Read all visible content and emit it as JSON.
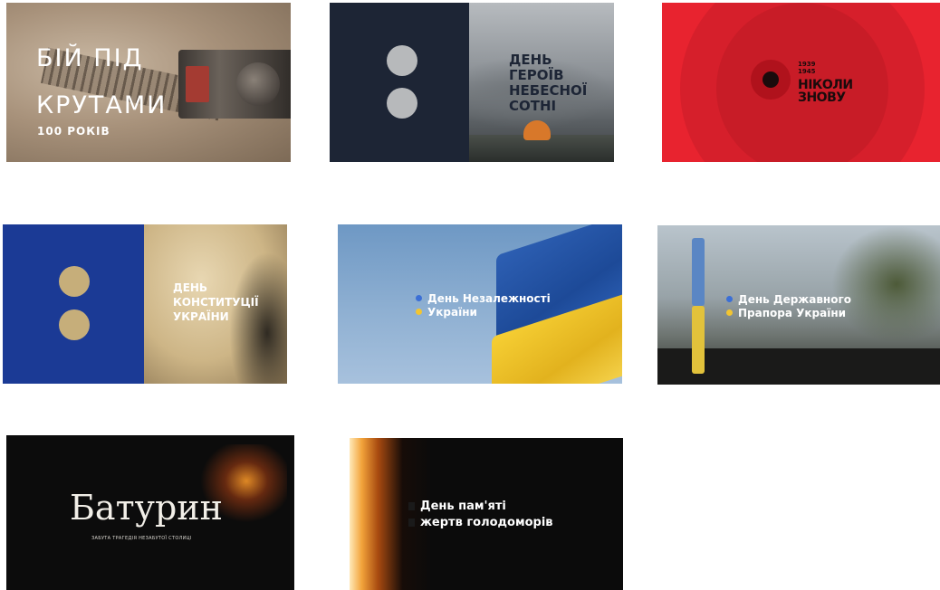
{
  "tiles": [
    {
      "title_lines": [
        "БІЙ ПІД",
        "КРУТАМИ"
      ],
      "subtitle": "100 РОКІВ"
    },
    {
      "title_lines": [
        "ДЕНЬ",
        "ГЕРОЇВ",
        "НЕБЕСНОЇ",
        "СОТНІ"
      ]
    },
    {
      "years_lines": [
        "1939",
        "1945"
      ],
      "title_lines": [
        "НІКОЛИ",
        "ЗНОВУ"
      ],
      "accent_color": "#e8232f"
    },
    {
      "title_lines": [
        "ДЕНЬ",
        "КОНСТИТУЦІЇ",
        "УКРАЇНИ"
      ]
    },
    {
      "label_lines": [
        "День Незалежності",
        "України"
      ],
      "bullet_colors": [
        "#3b6fd6",
        "#f2c531"
      ]
    },
    {
      "label_lines": [
        "День Державного",
        "Прапора України"
      ],
      "bullet_colors": [
        "#3b6fd6",
        "#f2c531"
      ]
    },
    {
      "title": "Батурин",
      "subtitle": "ЗАБУТА ТРАГЕДІЯ НЕЗАБУТОЇ СТОЛИЦІ"
    },
    {
      "label_lines": [
        "День пам'яті",
        "жертв голодоморів"
      ]
    }
  ]
}
